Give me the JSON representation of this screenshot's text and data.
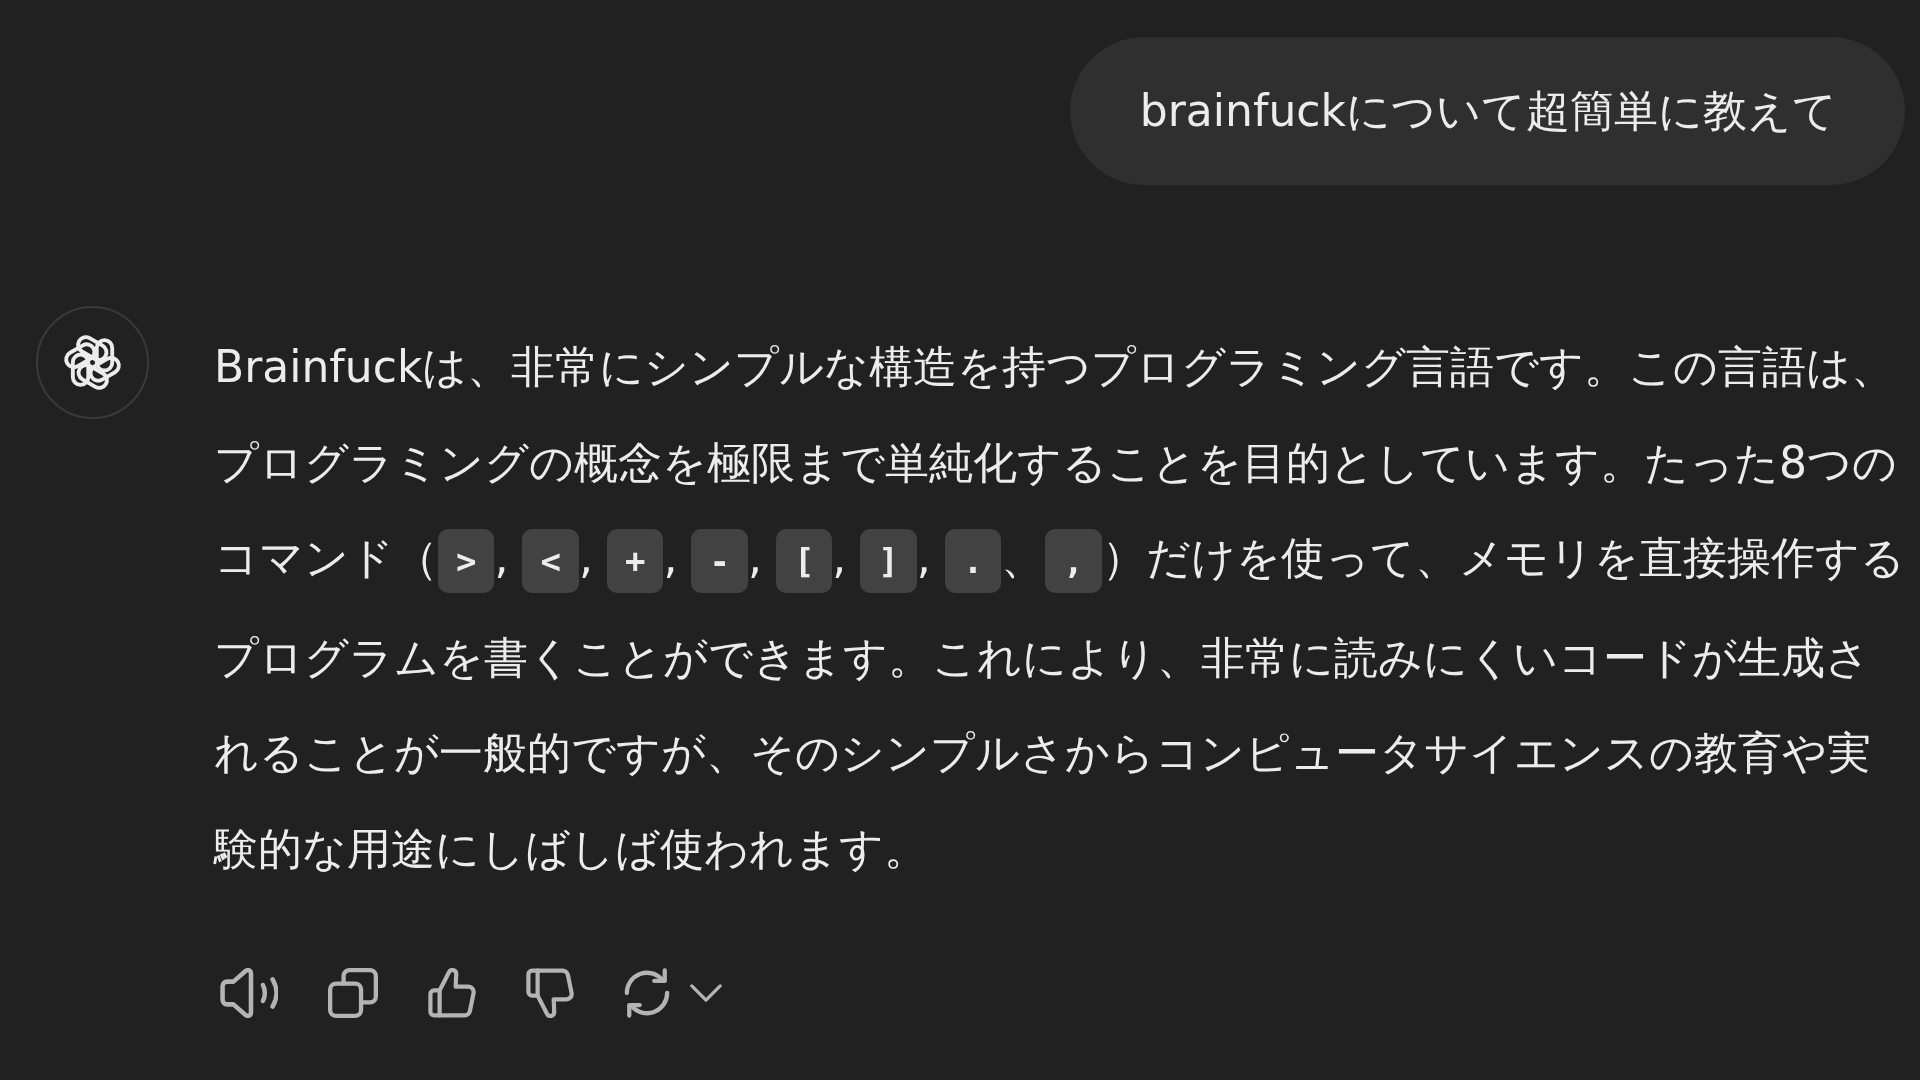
{
  "user_message": {
    "text": "brainfuckについて超簡単に教えて"
  },
  "assistant_message": {
    "paragraph": [
      {
        "kind": "text",
        "text": "Brainfuckは、非常にシンプルな構造を持つプログラミング言語です。この言語は、プログラミングの概念を極限まで単純化することを目的としています。たった8つのコマンド（"
      },
      {
        "kind": "code",
        "text": ">"
      },
      {
        "kind": "text",
        "text": ", "
      },
      {
        "kind": "code",
        "text": "<"
      },
      {
        "kind": "text",
        "text": ", "
      },
      {
        "kind": "code",
        "text": "+"
      },
      {
        "kind": "text",
        "text": ", "
      },
      {
        "kind": "code",
        "text": "-"
      },
      {
        "kind": "text",
        "text": ", "
      },
      {
        "kind": "code",
        "text": "["
      },
      {
        "kind": "text",
        "text": ", "
      },
      {
        "kind": "code",
        "text": "]"
      },
      {
        "kind": "text",
        "text": ", "
      },
      {
        "kind": "code",
        "text": "."
      },
      {
        "kind": "text",
        "text": "、"
      },
      {
        "kind": "code",
        "text": ","
      },
      {
        "kind": "text",
        "text": "）だけを使って、メモリを直接操作するプログラムを書くことができます。これにより、非常に読みにくいコードが生成されることが一般的ですが、そのシンプルさからコンピュータサイエンスの教育や実験的な用途にしばしば使われます。"
      }
    ]
  }
}
